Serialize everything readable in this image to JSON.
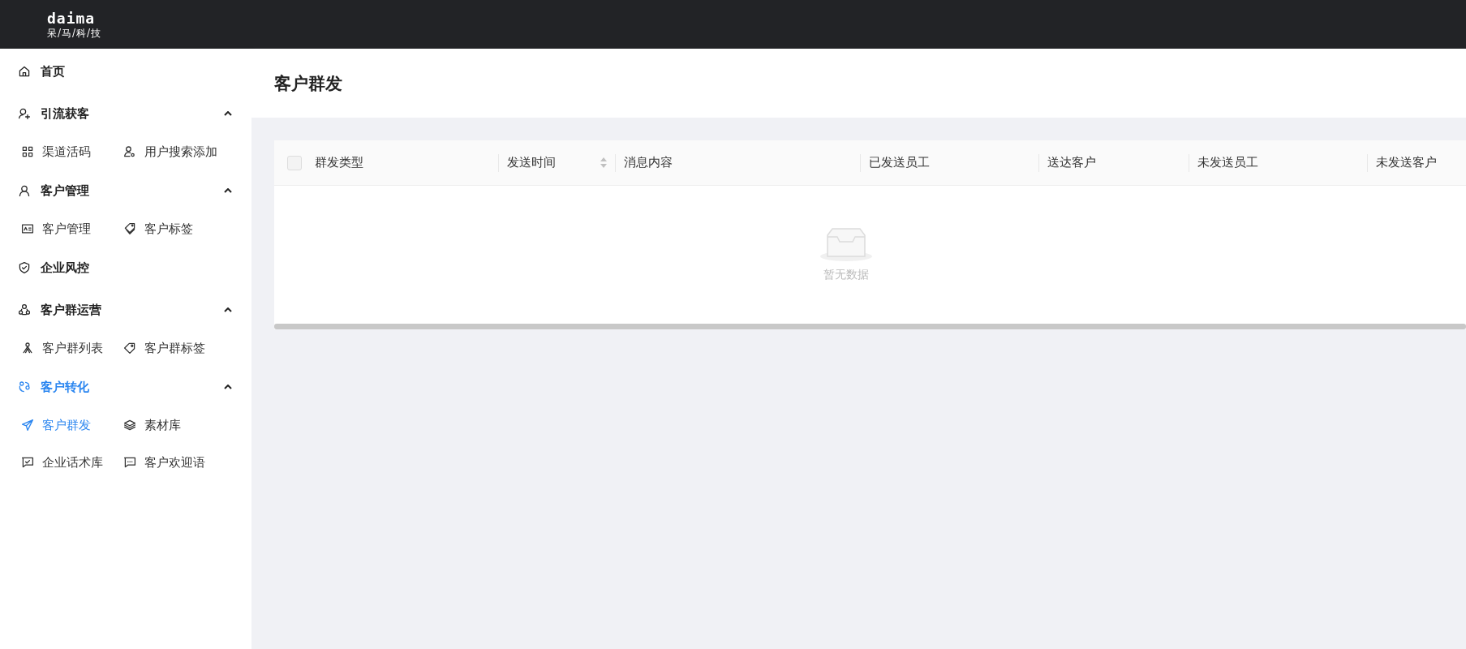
{
  "logo": {
    "wordmark": "daima",
    "tagline": "呆/马/科/技"
  },
  "sidebar": {
    "groups": [
      {
        "label": "首页",
        "selected": false
      },
      {
        "label": "引流获客",
        "expanded": true,
        "selected": false,
        "items": [
          {
            "label": "渠道活码",
            "selected": false
          },
          {
            "label": "用户搜索添加",
            "selected": false
          }
        ]
      },
      {
        "label": "客户管理",
        "expanded": true,
        "selected": false,
        "items": [
          {
            "label": "客户管理",
            "selected": false
          },
          {
            "label": "客户标签",
            "selected": false
          }
        ]
      },
      {
        "label": "企业风控",
        "selected": false
      },
      {
        "label": "客户群运营",
        "expanded": true,
        "selected": false,
        "items": [
          {
            "label": "客户群列表",
            "selected": false
          },
          {
            "label": "客户群标签",
            "selected": false
          }
        ]
      },
      {
        "label": "客户转化",
        "expanded": true,
        "selected": true,
        "items": [
          {
            "label": "客户群发",
            "selected": true
          },
          {
            "label": "素材库",
            "selected": false
          },
          {
            "label": "企业话术库",
            "selected": false
          },
          {
            "label": "客户欢迎语",
            "selected": false
          }
        ]
      }
    ]
  },
  "page": {
    "title": "客户群发"
  },
  "table": {
    "select_all_checked": false,
    "columns": [
      {
        "label": "群发类型",
        "sortable": false
      },
      {
        "label": "发送时间",
        "sortable": true
      },
      {
        "label": "消息内容",
        "sortable": false
      },
      {
        "label": "已发送员工",
        "sortable": false
      },
      {
        "label": "送达客户",
        "sortable": false
      },
      {
        "label": "未发送员工",
        "sortable": false
      },
      {
        "label": "未发送客户",
        "sortable": false
      }
    ],
    "empty_text": "暂无数据"
  }
}
